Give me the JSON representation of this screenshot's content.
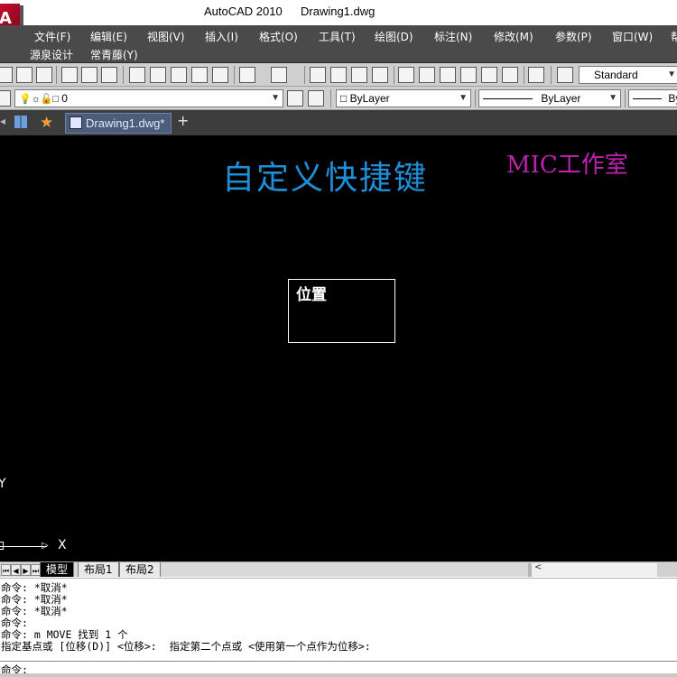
{
  "title": {
    "app": "AutoCAD 2010",
    "file": "Drawing1.dwg"
  },
  "menu": {
    "row1": [
      "文件(F)",
      "编辑(E)",
      "视图(V)",
      "插入(I)",
      "格式(O)",
      "工具(T)",
      "绘图(D)",
      "标注(N)",
      "修改(M)",
      "参数(P)",
      "窗口(W)",
      "帮"
    ],
    "row2": [
      "源泉设计",
      "常青藤(Y)"
    ]
  },
  "toolbar": {
    "text_style": "Standard",
    "layer": "0",
    "color": "ByLayer",
    "linetype": "ByLayer",
    "lineweight": "By"
  },
  "tabs": {
    "drawing": "Drawing1.dwg*",
    "new_tab": "+"
  },
  "canvas": {
    "heading": "自定义快捷键",
    "watermark": "MIC工作室",
    "box_label": "位置",
    "ucs_x": "X",
    "ucs_y": "Y"
  },
  "layout_tabs": [
    "模型",
    "布局1",
    "布局2"
  ],
  "command_history": [
    "命令: *取消*",
    "命令: *取消*",
    "命令: *取消*",
    "命令:",
    "命令: m MOVE 找到 1 个",
    "指定基点或 [位移(D)] <位移>:  指定第二个点或 <使用第一个点作为位移>:"
  ],
  "command_prompt": "命令:",
  "colors": {
    "canvas_bg": "#000000",
    "heading": "#1e8fd6",
    "watermark": "#c020b0",
    "menubar": "#4a4a4a"
  },
  "icons": [
    "app-logo",
    "new-file-icon",
    "open-icon",
    "save-icon",
    "print-icon",
    "cut-icon",
    "copy-icon",
    "paste-icon",
    "undo-icon",
    "redo-icon",
    "zoom-icon",
    "star-icon",
    "grid-icon"
  ]
}
